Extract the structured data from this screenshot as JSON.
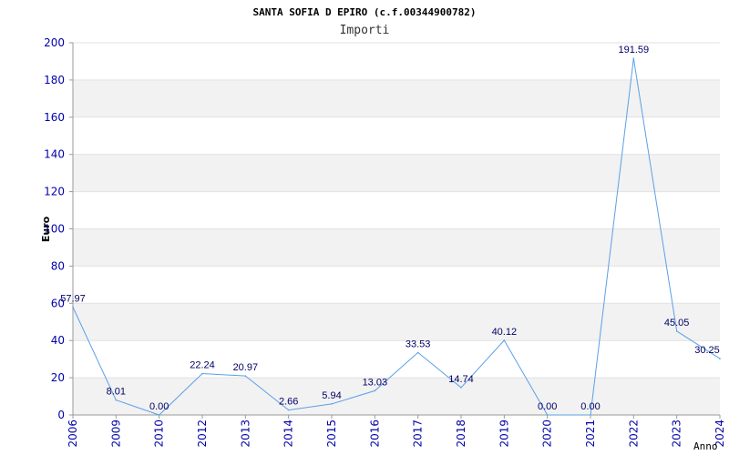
{
  "chart_data": {
    "type": "line",
    "title": "SANTA SOFIA D EPIRO (c.f.00344900782)",
    "subtitle": "Importi",
    "xlabel": "Anno",
    "ylabel": "Euro",
    "ylim": [
      0,
      200
    ],
    "yticks": [
      0,
      20,
      40,
      60,
      80,
      100,
      120,
      140,
      160,
      180,
      200
    ],
    "grid": true,
    "x": [
      "2006",
      "2009",
      "2010",
      "2012",
      "2013",
      "2014",
      "2015",
      "2016",
      "2017",
      "2018",
      "2019",
      "2020",
      "2021",
      "2022",
      "2023",
      "2024"
    ],
    "series": [
      {
        "values": [
          57.97,
          8.01,
          0.0,
          22.24,
          20.97,
          2.66,
          5.94,
          13.03,
          33.53,
          14.74,
          40.12,
          0.0,
          0.0,
          191.59,
          45.05,
          30.25
        ],
        "labels": [
          "57.97",
          "8.01",
          "0.00",
          "22.24",
          "20.97",
          "2.66",
          "5.94",
          "13.03",
          "33.53",
          "14.74",
          "40.12",
          "0.00",
          "0.00",
          "191.59",
          "45.05",
          "30.25"
        ],
        "color": "#5aa0e6"
      }
    ]
  }
}
